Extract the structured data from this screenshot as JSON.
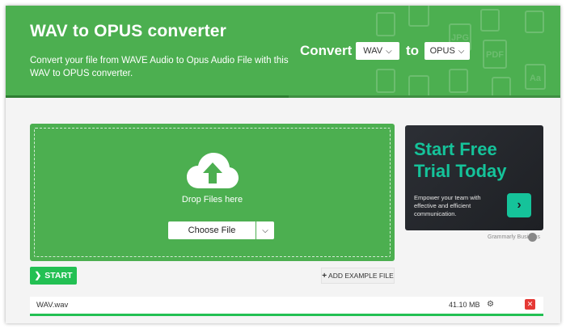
{
  "header": {
    "title": "WAV to OPUS converter",
    "description": "Convert your file from WAVE Audio to Opus Audio File with this WAV to OPUS converter.",
    "convert_label": "Convert",
    "to_label": "to",
    "from_format": "WAV",
    "to_format": "OPUS",
    "decor_labels": [
      "JPG",
      "PDF",
      "Aa"
    ]
  },
  "dropzone": {
    "drop_text": "Drop Files here",
    "choose_label": "Choose File"
  },
  "ad": {
    "headline_line1": "Start Free",
    "headline_line2": "Trial Today",
    "body": "Empower your team with effective and efficient communication.",
    "brand": "Grammarly Business"
  },
  "actions": {
    "start_label": "START",
    "example_label": "ADD EXAMPLE FILE"
  },
  "file": {
    "name": "WAV.wav",
    "size": "41.10 MB"
  },
  "colors": {
    "brand_green": "#4caf50",
    "start_green": "#23c053",
    "ad_accent": "#15c39a",
    "delete_red": "#e53935"
  }
}
